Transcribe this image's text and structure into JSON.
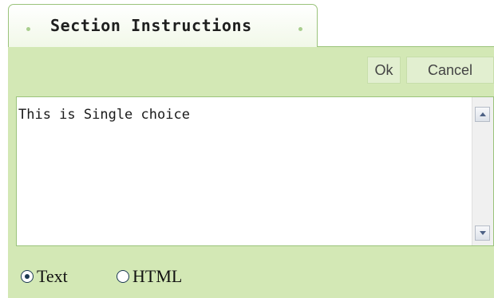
{
  "tab": {
    "title": "Section Instructions"
  },
  "toolbar": {
    "ok_label": "Ok",
    "cancel_label": "Cancel"
  },
  "editor": {
    "value": "This is Single choice"
  },
  "format": {
    "options": [
      {
        "label": "Text",
        "selected": true
      },
      {
        "label": "HTML",
        "selected": false
      }
    ]
  },
  "colors": {
    "panel_green": "#d3e8b5",
    "border_green": "#9bc37b",
    "button_bg": "#e2efd0"
  },
  "icons": {
    "tab_left": "dot-icon",
    "tab_right": "dot-icon",
    "scroll_up": "arrow-up-icon",
    "scroll_down": "arrow-down-icon"
  }
}
